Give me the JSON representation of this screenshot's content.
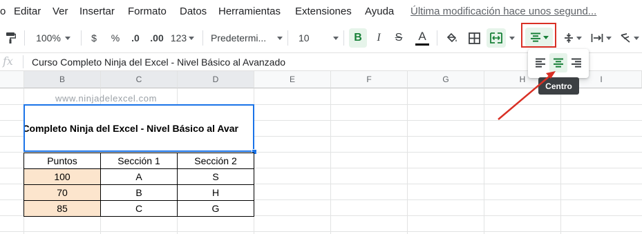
{
  "menu": {
    "items": [
      "o",
      "Editar",
      "Ver",
      "Insertar",
      "Formato",
      "Datos",
      "Herramientas",
      "Extensiones",
      "Ayuda"
    ],
    "last_modified": "Última modificación hace unos segund..."
  },
  "toolbar": {
    "zoom": "100%",
    "currency": "$",
    "percent": "%",
    "decrease_decimal": ".0",
    "increase_decimal": ".00",
    "more_formats": "123",
    "font_family": "Predetermi...",
    "font_size": "10",
    "bold": "B",
    "italic": "I",
    "strikethrough": "S",
    "text_color": "A",
    "accent_color": "#188038",
    "highlight_color": "#d93025"
  },
  "formula_bar": {
    "fx": "fx",
    "content": "Curso Completo Ninja del Excel - Nivel Básico al Avanzado"
  },
  "columns": [
    "B",
    "C",
    "D",
    "E",
    "F",
    "G",
    "H",
    "I"
  ],
  "sheet": {
    "watermark": "www.ninjadelexcel.com",
    "title_cell": "o Completo Ninja del Excel - Nivel Básico al Avar",
    "headers": [
      "Puntos",
      "Sección 1",
      "Sección 2"
    ],
    "rows": [
      [
        "100",
        "A",
        "S"
      ],
      [
        "70",
        "B",
        "H"
      ],
      [
        "85",
        "C",
        "G"
      ]
    ],
    "peach_color": "#fce5cd"
  },
  "align_popup": {
    "tooltip": "Centro",
    "options": [
      "left",
      "center",
      "right"
    ],
    "selected": "center"
  }
}
